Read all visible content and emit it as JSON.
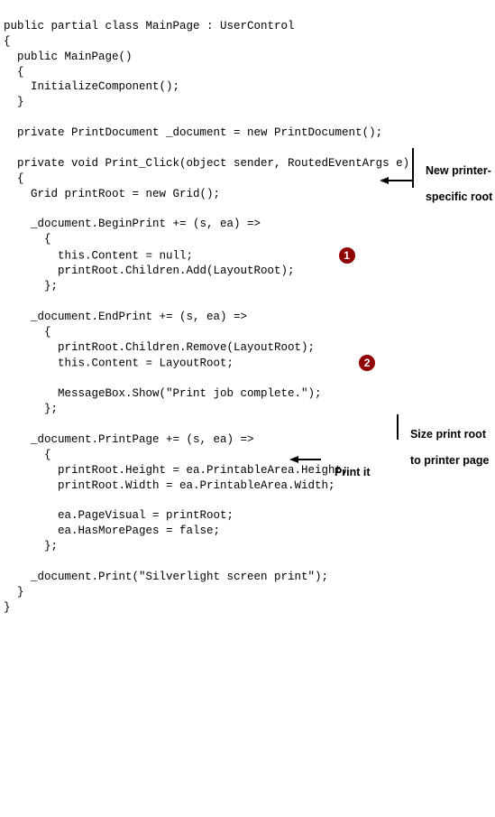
{
  "code": {
    "l1": "public partial class MainPage : UserControl",
    "l2": "{",
    "l3": "  public MainPage()",
    "l4": "  {",
    "l5": "    InitializeComponent();",
    "l6": "  }",
    "l7": "",
    "l8": "  private PrintDocument _document = new PrintDocument();",
    "l9": "",
    "l10": "  private void Print_Click(object sender, RoutedEventArgs e)",
    "l11": "  {",
    "l12": "    Grid printRoot = new Grid();",
    "l13": "",
    "l14": "    _document.BeginPrint += (s, ea) =>",
    "l15": "      {",
    "l16": "        this.Content = null;",
    "l17": "        printRoot.Children.Add(LayoutRoot);",
    "l18": "      };",
    "l19": "",
    "l20": "    _document.EndPrint += (s, ea) =>",
    "l21": "      {",
    "l22": "        printRoot.Children.Remove(LayoutRoot);",
    "l23": "        this.Content = LayoutRoot;",
    "l24": "",
    "l25": "        MessageBox.Show(\"Print job complete.\");",
    "l26": "      };",
    "l27": "",
    "l28": "    _document.PrintPage += (s, ea) =>",
    "l29": "      {",
    "l30": "        printRoot.Height = ea.PrintableArea.Height;",
    "l31": "        printRoot.Width = ea.PrintableArea.Width;",
    "l32": "",
    "l33": "        ea.PageVisual = printRoot;",
    "l34": "        ea.HasMorePages = false;",
    "l35": "      };",
    "l36": "",
    "l37": "    _document.Print(\"Silverlight screen print\");",
    "l38": "  }",
    "l39": "}"
  },
  "callouts": {
    "c1": "1",
    "c2": "2"
  },
  "annotations": {
    "new_root_l1": "New printer-",
    "new_root_l2": "specific root",
    "size_l1": "Size print root",
    "size_l2": "to printer page",
    "print_it": "Print it"
  }
}
